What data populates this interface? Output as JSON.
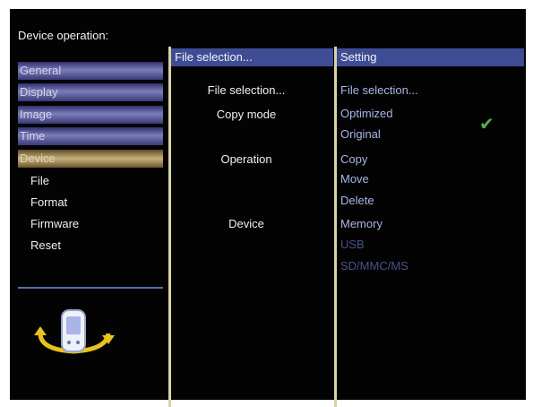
{
  "screen": {
    "title": "Device operation:",
    "left_menu": [
      {
        "label": "General",
        "active": false
      },
      {
        "label": "Display",
        "active": false
      },
      {
        "label": "Image",
        "active": false
      },
      {
        "label": "Time",
        "active": false
      },
      {
        "label": "Device",
        "active": true
      }
    ],
    "device_submenu": [
      "File",
      "Format",
      "Firmware",
      "Reset"
    ],
    "middle": {
      "header": "File selection...",
      "items": [
        "File selection...",
        "Copy mode",
        "Operation",
        "Device"
      ]
    },
    "right": {
      "header": "Setting",
      "items": [
        {
          "label": "File selection...",
          "enabled": true,
          "selected": false
        },
        {
          "label": "Optimized",
          "enabled": true,
          "selected": false
        },
        {
          "label": "Original",
          "enabled": true,
          "selected": true
        },
        {
          "label": "Copy",
          "enabled": true,
          "selected": false
        },
        {
          "label": "Move",
          "enabled": true,
          "selected": false
        },
        {
          "label": "Delete",
          "enabled": true,
          "selected": false
        },
        {
          "label": "Memory",
          "enabled": true,
          "selected": false
        },
        {
          "label": "USB",
          "enabled": false,
          "selected": false
        },
        {
          "label": "SD/MMC/MS",
          "enabled": false,
          "selected": false
        }
      ]
    },
    "checkmark": "✔",
    "icons": {
      "device": "rotate-device-icon",
      "selected": "check-icon"
    }
  }
}
